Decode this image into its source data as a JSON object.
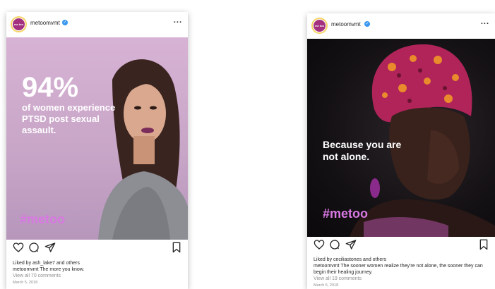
{
  "colors": {
    "accent_pink": "#d878e2",
    "verified_blue": "#3897f0",
    "avatar_purple": "#a3317f"
  },
  "post1": {
    "username": "metoomvmt",
    "avatar_text": "me too",
    "more_label": "...",
    "stat": "94%",
    "stat_text": "of women experience PTSD post sexual assault.",
    "hashtag": "#metoo",
    "likes": "Liked by ash_lake7 and others",
    "caption": "metoomvmt The more you know.",
    "comments_link": "View all 70 comments",
    "date": "March 5, 2018"
  },
  "post2": {
    "username": "metoomvmt",
    "avatar_text": "me too",
    "more_label": "...",
    "overlay_text": "Because you are not alone.",
    "hashtag": "#metoo",
    "likes": "Liked by ceciliastones and others",
    "caption": "metoomvmt The sooner women realize they're not alone, the sooner they can begin their healing journey.",
    "comments_link": "View all 19 comments",
    "date": "March 5, 2018"
  },
  "icons": [
    "heart-icon",
    "comment-icon",
    "share-icon",
    "bookmark-icon",
    "verified-icon",
    "more-icon"
  ]
}
